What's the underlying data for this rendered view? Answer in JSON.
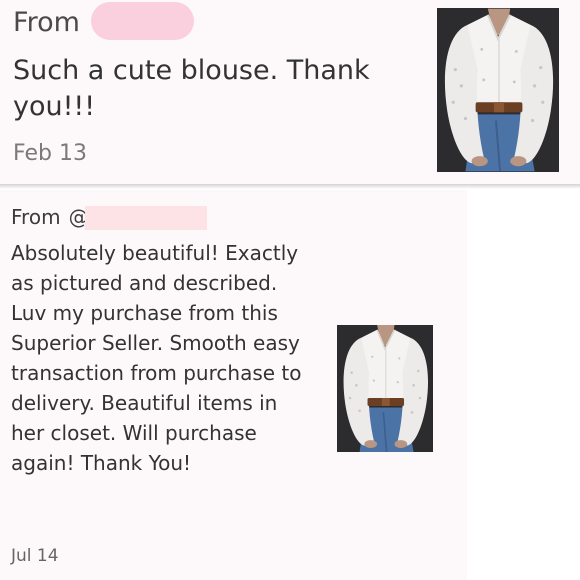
{
  "reviews": [
    {
      "from_label": "From",
      "message": "Such a cute blouse. Thank you!!!",
      "date": "Feb 13",
      "photo_icon": "blouse-photo"
    },
    {
      "from_label": "From",
      "handle_prefix": "@",
      "message": "Absolutely beautiful! Exactly as pictured and described. Luv my purchase from this Superior Seller. Smooth easy transaction from purchase to delivery. Beautiful items in her closet. Will purchase again! Thank You!",
      "date": "Jul 14",
      "photo_icon": "blouse-photo"
    }
  ],
  "colors": {
    "card_bg": "#fdf8f9",
    "redaction_pink": "#fbd0de",
    "redaction_peach": "#fde3e5"
  }
}
